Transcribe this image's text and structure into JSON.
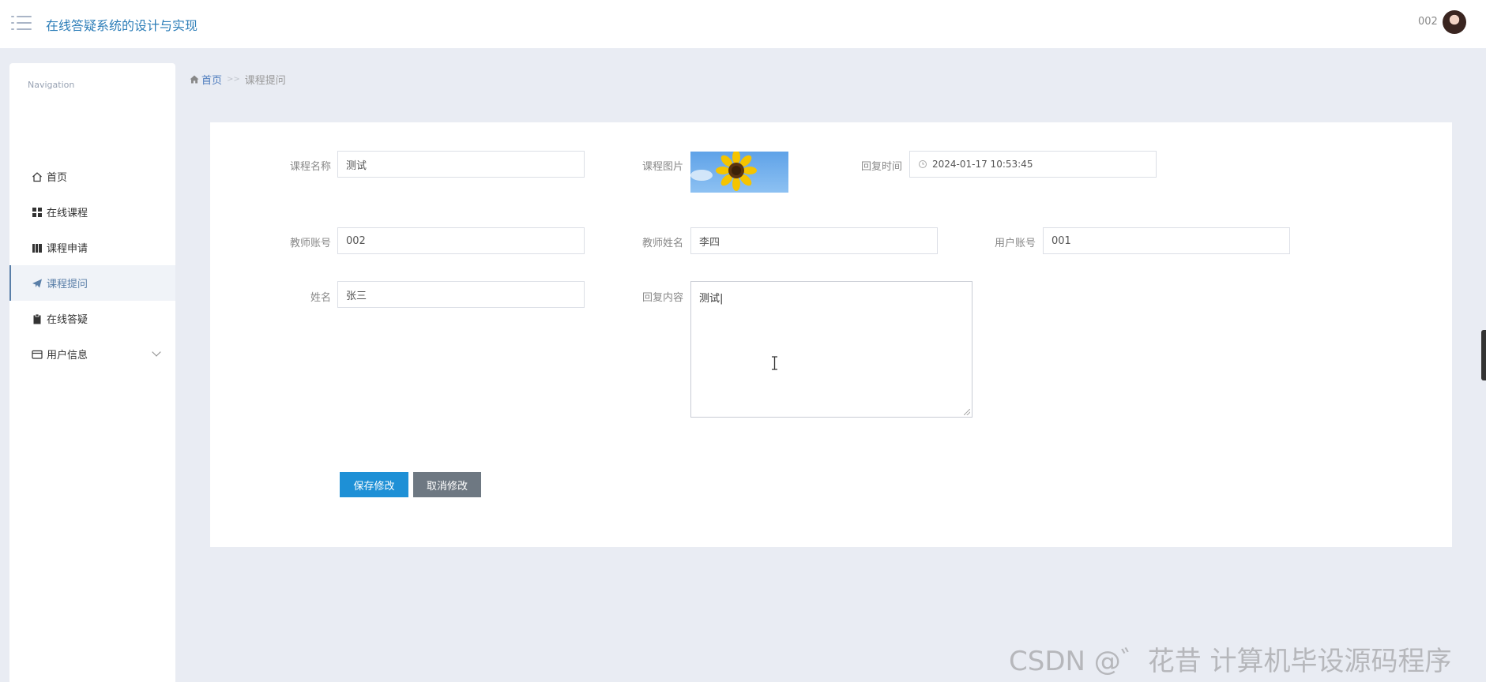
{
  "header": {
    "title": "在线答疑系统的设计与实现",
    "user": "002"
  },
  "sidebar": {
    "section": "Navigation",
    "items": [
      {
        "label": "首页",
        "icon": "home-icon"
      },
      {
        "label": "在线课程",
        "icon": "grid-icon"
      },
      {
        "label": "课程申请",
        "icon": "book-icon"
      },
      {
        "label": "课程提问",
        "icon": "paper-plane-icon"
      },
      {
        "label": "在线答疑",
        "icon": "clipboard-icon"
      },
      {
        "label": "用户信息",
        "icon": "card-icon"
      }
    ],
    "active_index": 3
  },
  "breadcrumb": {
    "home": "首页",
    "sep": ">>",
    "current": "课程提问"
  },
  "form": {
    "course_name_label": "课程名称",
    "course_name_value": "测试",
    "course_image_label": "课程图片",
    "reply_time_label": "回复时间",
    "reply_time_value": "2024-01-17 10:53:45",
    "teacher_account_label": "教师账号",
    "teacher_account_value": "002",
    "teacher_name_label": "教师姓名",
    "teacher_name_value": "李四",
    "user_account_label": "用户账号",
    "user_account_value": "001",
    "name_label": "姓名",
    "name_value": "张三",
    "reply_content_label": "回复内容",
    "reply_content_value": "测试|",
    "save_button": "保存修改",
    "cancel_button": "取消修改"
  },
  "watermark": "CSDN @゛花昔 计算机毕设源码程序",
  "colors": {
    "accent": "#1e90d6",
    "title": "#2d7eb8",
    "cancel": "#6e7882",
    "background": "#e9ecf3"
  }
}
